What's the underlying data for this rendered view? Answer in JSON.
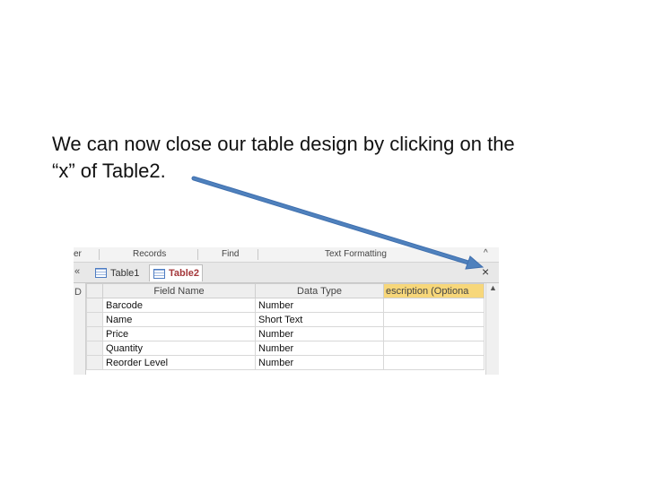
{
  "caption": {
    "line1": "We can now close our table design by clicking on the",
    "line2": "“x” of Table2."
  },
  "ribbon": {
    "groups": [
      "er",
      "Records",
      "Find",
      "Text Formatting"
    ]
  },
  "tabs": [
    {
      "label": "Table1",
      "active": false
    },
    {
      "label": "Table2",
      "active": true
    }
  ],
  "nav_chevron": "«",
  "left_strip_glyph": "D",
  "close_glyph": "×",
  "grid": {
    "headers": [
      "Field Name",
      "Data Type",
      "escription (Optiona"
    ],
    "rows": [
      {
        "field": "Barcode",
        "type": "Number",
        "desc": ""
      },
      {
        "field": "Name",
        "type": "Short Text",
        "desc": ""
      },
      {
        "field": "Price",
        "type": "Number",
        "desc": ""
      },
      {
        "field": "Quantity",
        "type": "Number",
        "desc": ""
      },
      {
        "field": "Reorder Level",
        "type": "Number",
        "desc": ""
      }
    ]
  },
  "colors": {
    "arrow": "#4f81bd",
    "active_tab_text": "#a4373a",
    "description_header": "#f7d77a"
  }
}
